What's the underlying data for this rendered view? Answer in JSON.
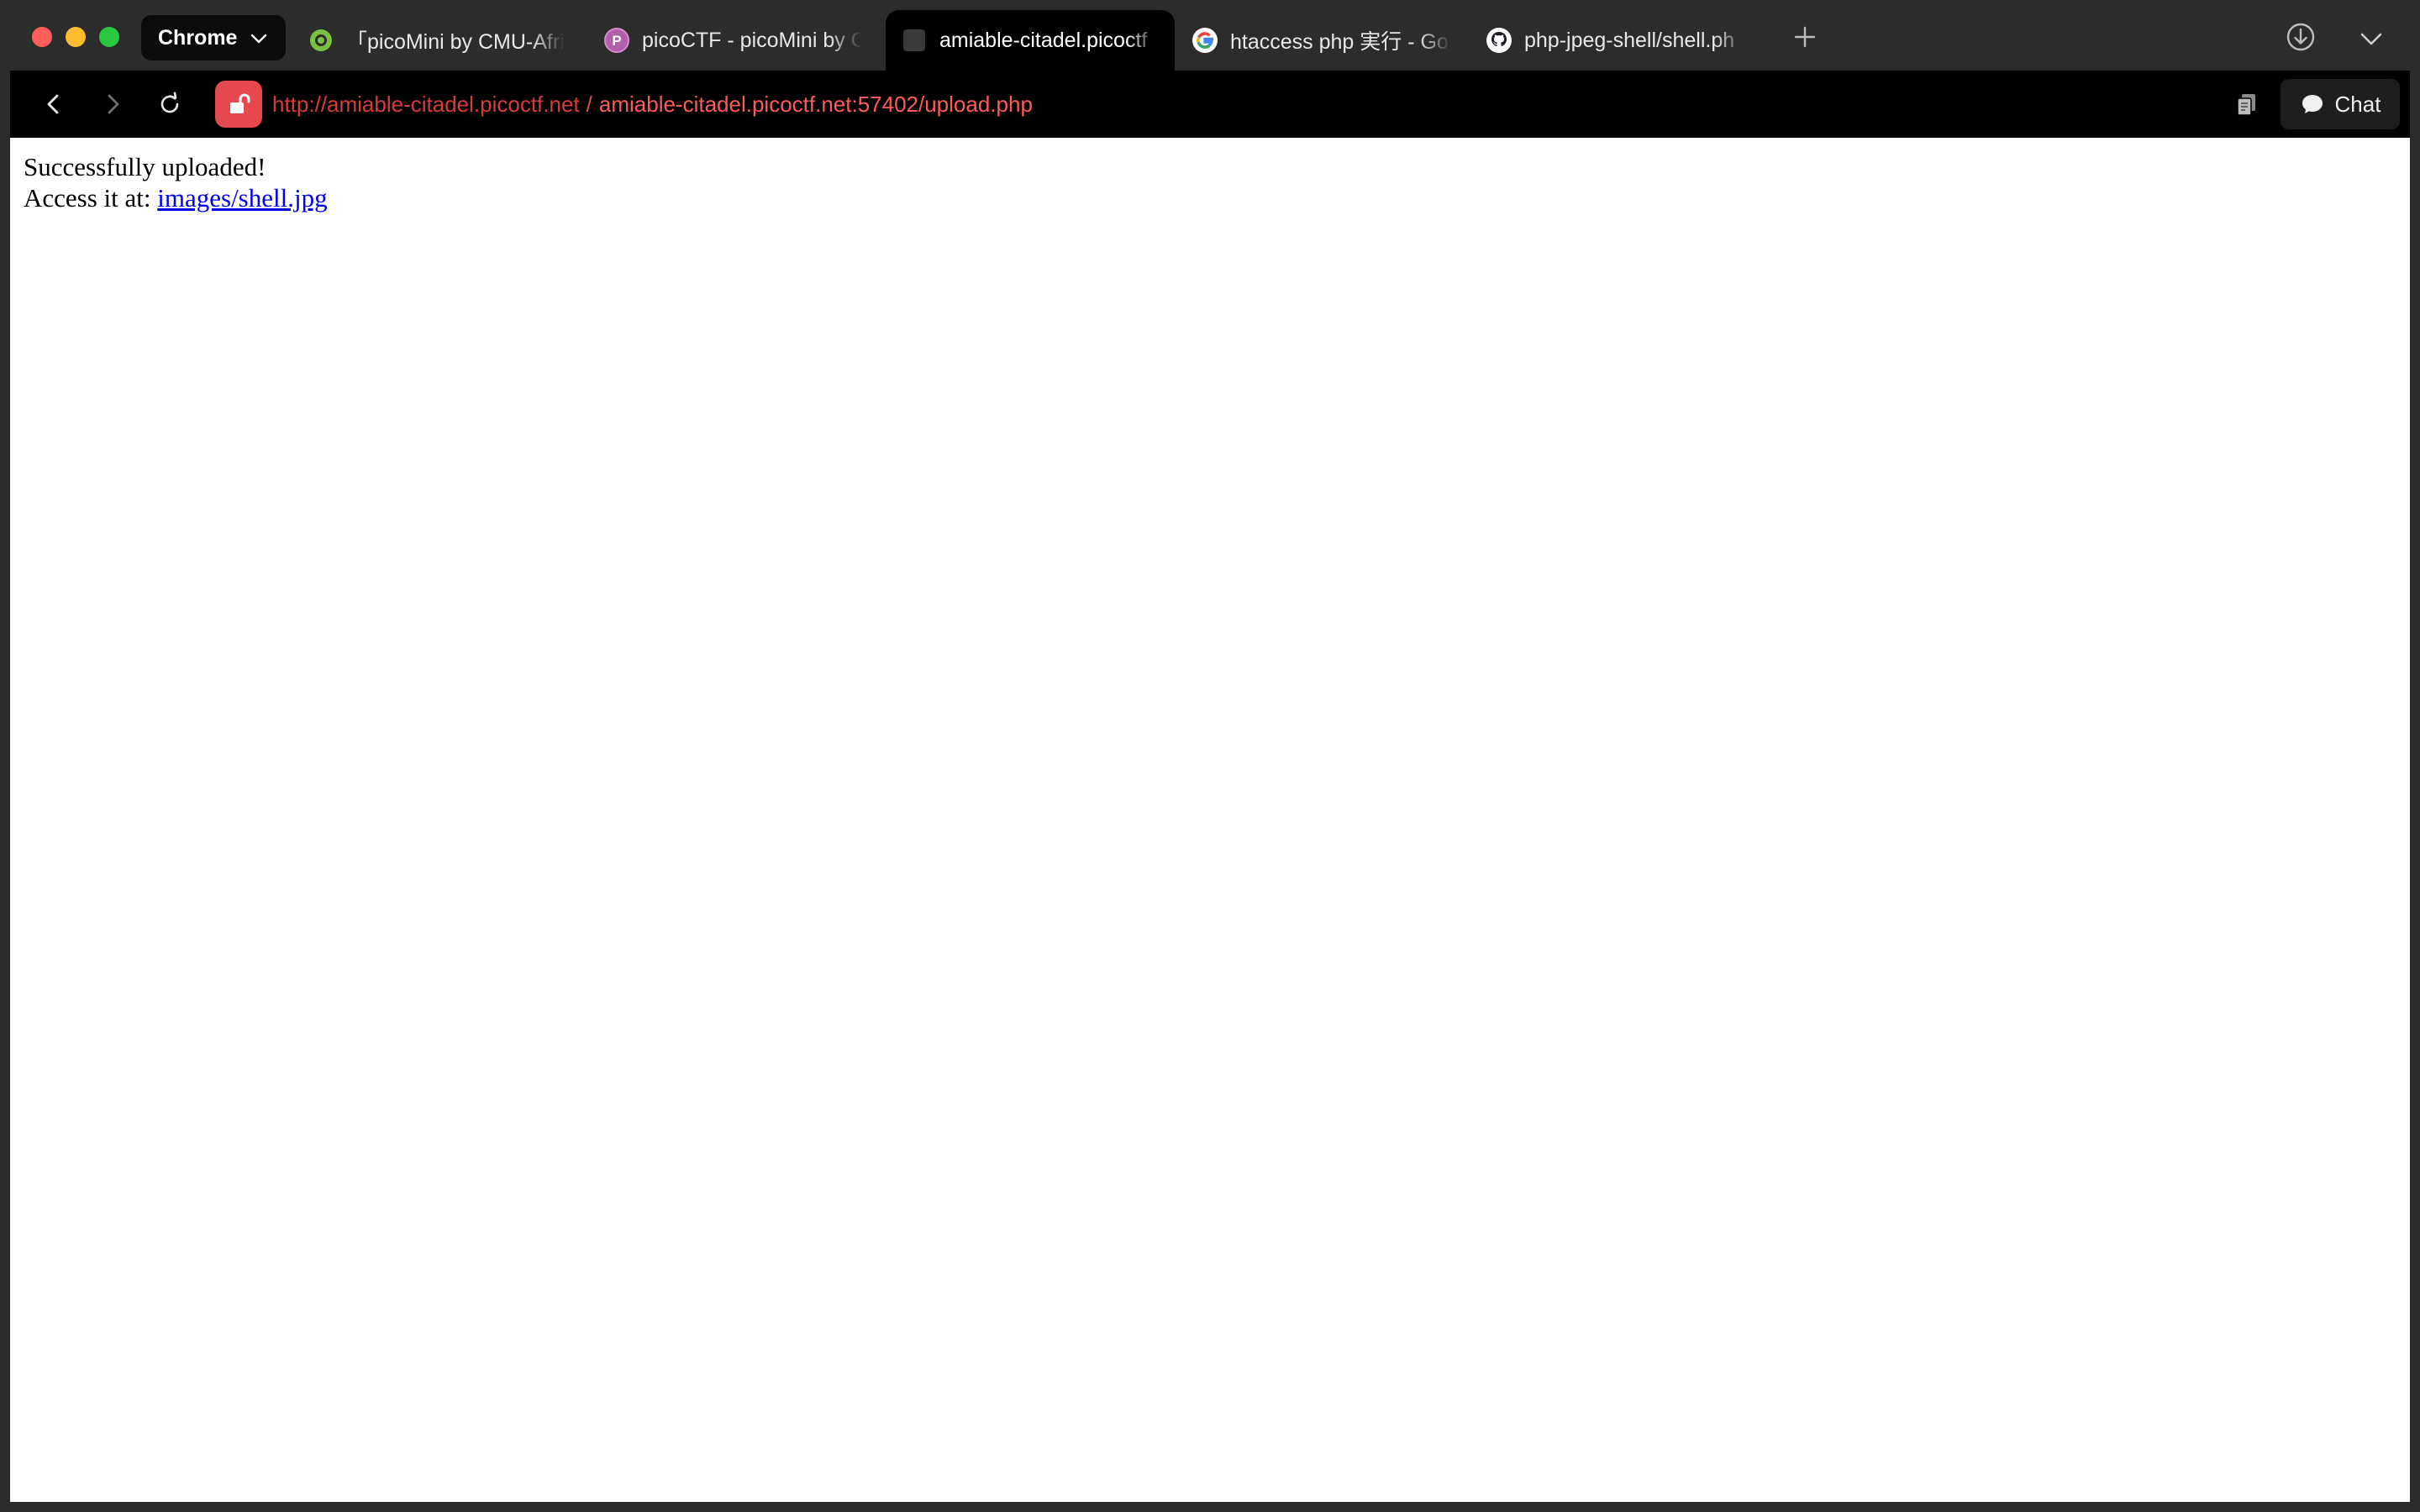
{
  "browser": {
    "app_menu_label": "Chrome",
    "tabs": [
      {
        "title": "「picoMini by CMU-Afric",
        "icon": "green-ring-icon",
        "active": false
      },
      {
        "title": "picoCTF - picoMini by C",
        "icon": "picoctf-icon",
        "active": false
      },
      {
        "title": "amiable-citadel.picoctf",
        "icon": "blank-page-icon",
        "active": true
      },
      {
        "title": "htaccess php 実行 - Go",
        "icon": "google-icon",
        "active": false
      },
      {
        "title": "php-jpeg-shell/shell.ph",
        "icon": "github-icon",
        "active": false
      }
    ]
  },
  "toolbar": {
    "url_origin": "http://amiable-citadel.picoctf.net",
    "url_separator": "/",
    "url_path": "amiable-citadel.picoctf.net:57402/upload.php",
    "chat_label": "Chat",
    "security_color": "#e5484d"
  },
  "page": {
    "message": "Successfully uploaded!",
    "access_label": "Access it at:",
    "link_text": "images/shell.jpg"
  }
}
